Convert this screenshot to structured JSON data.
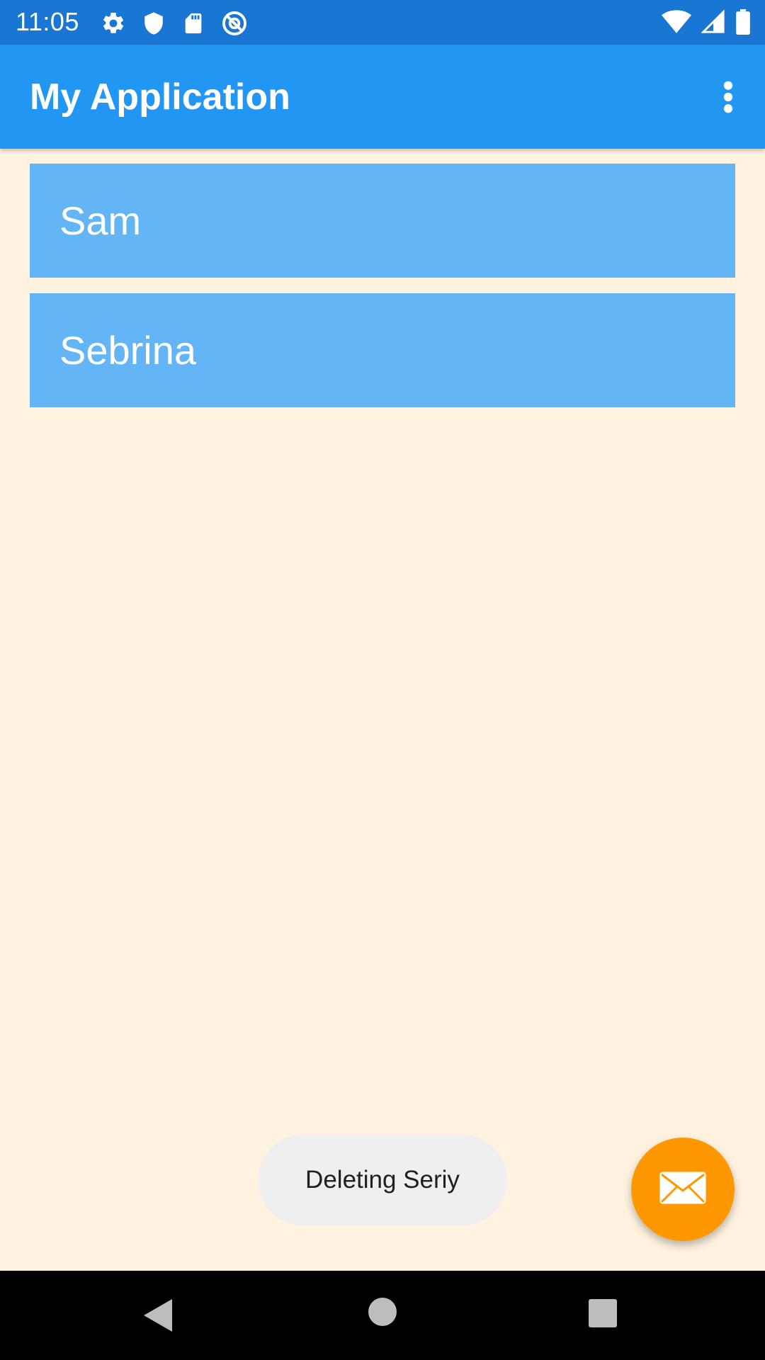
{
  "status_bar": {
    "time": "11:05",
    "left_icons": [
      "settings-icon",
      "shield-icon",
      "sd-card-icon",
      "at-sign-icon"
    ],
    "right_icons": [
      "wifi-icon",
      "cell-signal-icon",
      "battery-icon"
    ]
  },
  "app_bar": {
    "title": "My Application",
    "menu_icon": "more-vert-icon"
  },
  "list": {
    "items": [
      {
        "label": "Sam"
      },
      {
        "label": "Sebrina"
      }
    ]
  },
  "toast": {
    "message": "Deleting Seriy"
  },
  "fab": {
    "icon": "mail-icon"
  },
  "nav_bar": {
    "buttons": [
      "back-icon",
      "home-icon",
      "recents-icon"
    ]
  },
  "colors": {
    "status_bar": "#1976D2",
    "app_bar": "#2196F3",
    "background": "#FFF3E0",
    "list_item": "#64B5F6",
    "fab": "#FF9800",
    "toast": "#EFEFEF",
    "nav_bar": "#000000"
  }
}
